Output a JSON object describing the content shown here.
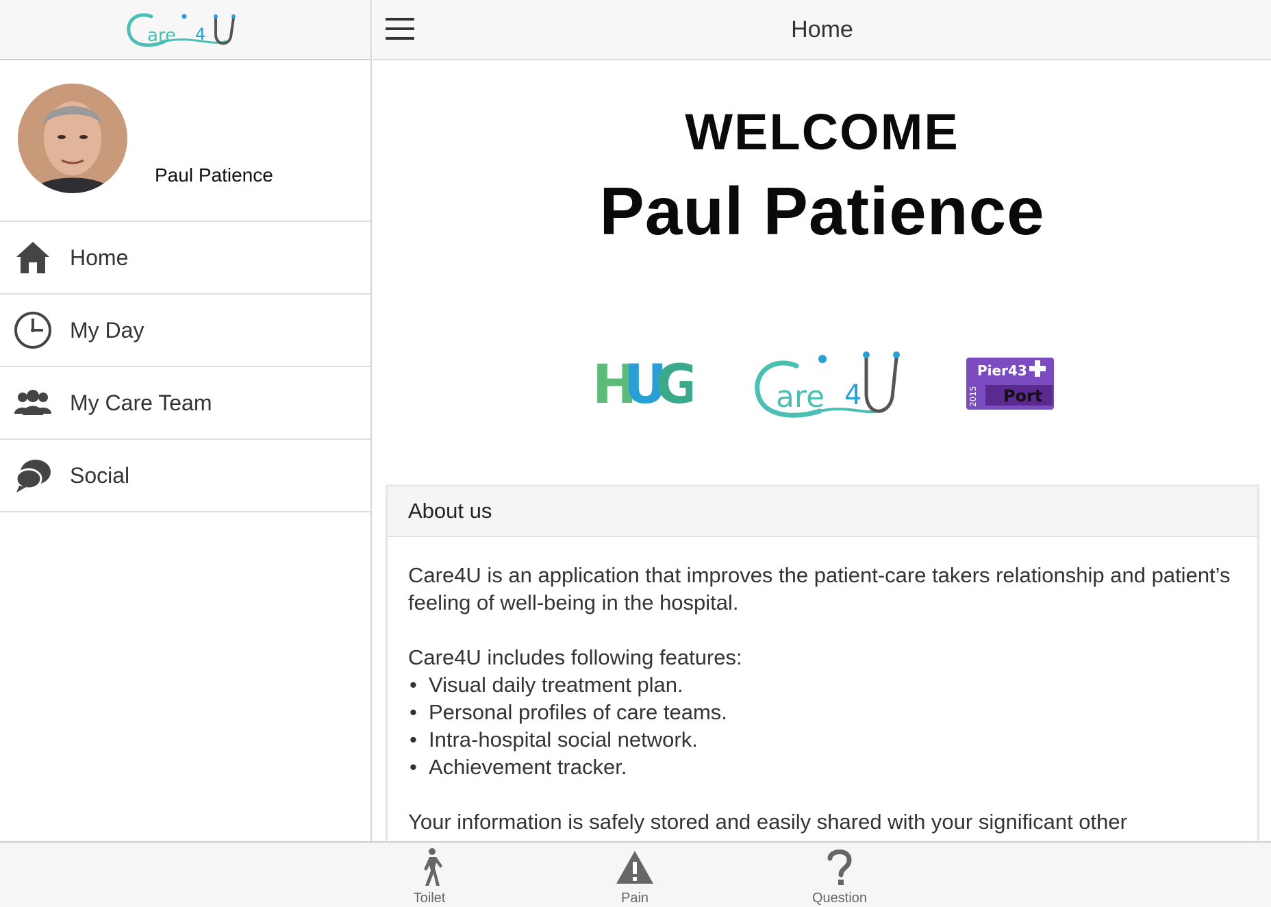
{
  "app": {
    "brand": "Care4U"
  },
  "sidebar": {
    "profile": {
      "name": "Paul Patience"
    },
    "items": [
      {
        "label": "Home",
        "icon": "home-icon"
      },
      {
        "label": "My Day",
        "icon": "clock-icon"
      },
      {
        "label": "My Care Team",
        "icon": "team-icon"
      },
      {
        "label": "Social",
        "icon": "chat-icon"
      }
    ]
  },
  "header": {
    "title": "Home"
  },
  "welcome": {
    "line1": "WELCOME",
    "line2": "Paul Patience"
  },
  "logos": [
    {
      "name": "HUG",
      "text": "HUG"
    },
    {
      "name": "Care4U",
      "text": "Care4U"
    },
    {
      "name": "Pier43 Port",
      "text": "Pier43 Port",
      "year": "2015"
    }
  ],
  "about": {
    "title": "About us",
    "intro": "Care4U is an application that improves the patient-care takers relationship and patient’s feeling of well-being in the hospital.",
    "features_intro": "Care4U includes following features:",
    "features": [
      "Visual daily treatment plan.",
      "Personal profiles of care teams.",
      "Intra-hospital social network.",
      "Achievement tracker."
    ],
    "storage": "Your information is safely stored and easily shared with your significant other"
  },
  "tabbar": {
    "items": [
      {
        "label": "Toilet",
        "icon": "walking-person-icon"
      },
      {
        "label": "Pain",
        "icon": "warning-icon"
      },
      {
        "label": "Question",
        "icon": "question-icon"
      }
    ]
  },
  "colors": {
    "brand_teal": "#4bbfb3",
    "brand_blue": "#2a9fd6",
    "hug_green": "#5dbb7a",
    "pier43_purple": "#7a4cc0",
    "icon_gray": "#444444"
  }
}
